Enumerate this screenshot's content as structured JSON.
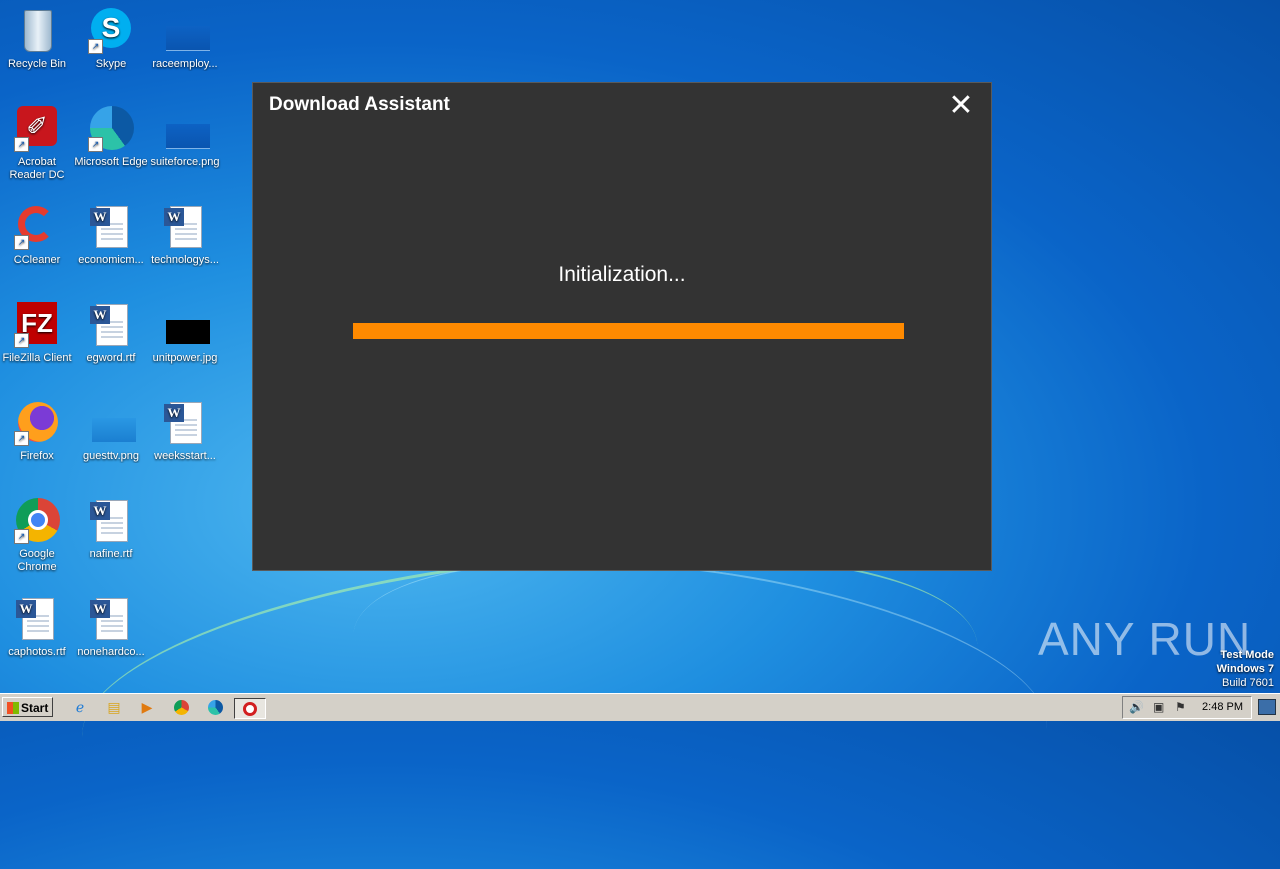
{
  "desktop_icons": [
    {
      "label": "Recycle Bin"
    },
    {
      "label": "Skype"
    },
    {
      "label": "raceemploy..."
    },
    {
      "label": "Acrobat Reader DC"
    },
    {
      "label": "Microsoft Edge"
    },
    {
      "label": "suiteforce.png"
    },
    {
      "label": "CCleaner"
    },
    {
      "label": "economicm..."
    },
    {
      "label": "technologys..."
    },
    {
      "label": "FileZilla Client"
    },
    {
      "label": "egword.rtf"
    },
    {
      "label": "unitpower.jpg"
    },
    {
      "label": "Firefox"
    },
    {
      "label": "guesttv.png"
    },
    {
      "label": "weeksstart..."
    },
    {
      "label": "Google Chrome"
    },
    {
      "label": "nafine.rtf"
    },
    {
      "label": "caphotos.rtf"
    },
    {
      "label": "nonehardco..."
    }
  ],
  "dialog": {
    "title": "Download Assistant",
    "close_glyph": "✕",
    "status_text": "Initialization...",
    "progress_percent": 100,
    "progress_color": "#ff8a00"
  },
  "watermark": {
    "brand": "ANY RUN",
    "line1": "Test Mode",
    "line2": "Windows 7",
    "line3": "Build 7601"
  },
  "taskbar": {
    "start_label": "Start",
    "clock": "2:48 PM"
  }
}
